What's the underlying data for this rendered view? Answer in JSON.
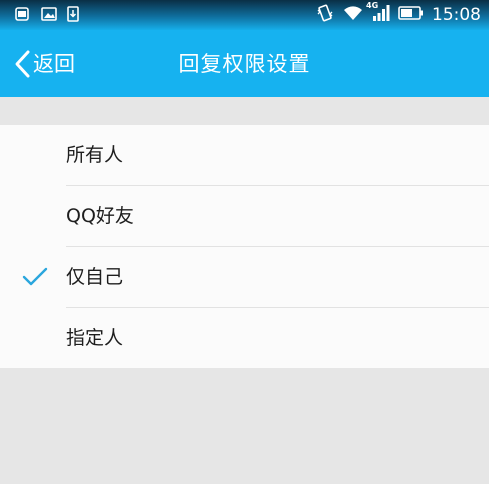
{
  "status_bar": {
    "time": "15:08",
    "network": "4G"
  },
  "header": {
    "back_label": "返回",
    "title": "回复权限设置"
  },
  "options": [
    {
      "label": "所有人",
      "selected": false
    },
    {
      "label": "QQ好友",
      "selected": false
    },
    {
      "label": "仅自己",
      "selected": true
    },
    {
      "label": "指定人",
      "selected": false
    }
  ],
  "colors": {
    "accent": "#16b2f0",
    "check": "#2aa6dd",
    "background": "#e6e6e6"
  }
}
